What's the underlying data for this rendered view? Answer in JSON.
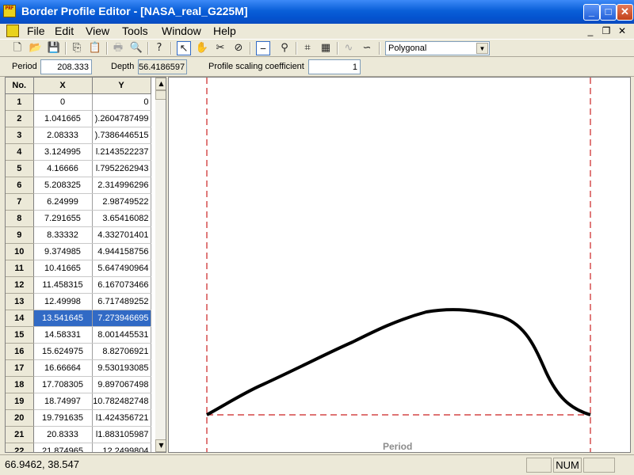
{
  "window": {
    "title": "Border Profile Editor - [NASA_real_G225M]",
    "icon_text": "PRF",
    "min": "_",
    "max": "□",
    "close": "✕"
  },
  "menu": {
    "items": [
      "File",
      "Edit",
      "View",
      "Tools",
      "Window",
      "Help"
    ],
    "mdi_minimize": "_",
    "mdi_restore": "❐",
    "mdi_close": "✕"
  },
  "toolbar": {
    "icons": [
      "new-file-icon",
      "open-folder-icon",
      "save-icon",
      "copy-icon",
      "paste-icon",
      "print-icon",
      "print-preview-icon",
      "help-icon",
      "pointer-icon",
      "hand-icon",
      "cut-icon",
      "zoom-icon",
      "line-tool-icon",
      "magnify-icon",
      "grid-icon",
      "grid-lines-icon",
      "spline-icon",
      "curve-icon"
    ],
    "mode_value": "Polygonal"
  },
  "params": {
    "period_label": "Period",
    "period_value": "208.333",
    "depth_label": "Depth",
    "depth_value": "56.4186597",
    "scaling_label": "Profile scaling coefficient",
    "scaling_value": "1"
  },
  "table": {
    "headers": [
      "No.",
      "X",
      "Y"
    ],
    "selected_row": 14,
    "rows": [
      [
        "1",
        "0",
        "0"
      ],
      [
        "2",
        "1.041665",
        ").2604787499"
      ],
      [
        "3",
        "2.08333",
        ").7386446515"
      ],
      [
        "4",
        "3.124995",
        "l.2143522237"
      ],
      [
        "5",
        "4.16666",
        "l.7952262943"
      ],
      [
        "6",
        "5.208325",
        "2.314996296"
      ],
      [
        "7",
        "6.24999",
        "2.98749522"
      ],
      [
        "8",
        "7.291655",
        "3.65416082"
      ],
      [
        "9",
        "8.33332",
        "4.332701401"
      ],
      [
        "10",
        "9.374985",
        "4.944158756"
      ],
      [
        "11",
        "10.41665",
        "5.647490964"
      ],
      [
        "12",
        "11.458315",
        "6.167073466"
      ],
      [
        "13",
        "12.49998",
        "6.717489252"
      ],
      [
        "14",
        "13.541645",
        "7.273946695"
      ],
      [
        "15",
        "14.58331",
        "8.001445531"
      ],
      [
        "16",
        "15.624975",
        "8.82706921"
      ],
      [
        "17",
        "16.66664",
        "9.530193085"
      ],
      [
        "18",
        "17.708305",
        "9.897067498"
      ],
      [
        "19",
        "18.74997",
        "10.782482748"
      ],
      [
        "20",
        "19.791635",
        "l1.424356721"
      ],
      [
        "21",
        "20.8333",
        "l1.883105987"
      ],
      [
        "22",
        "21.874965",
        "12.2499804"
      ]
    ]
  },
  "canvas": {
    "axis_label": "Period",
    "profile_color": "#000000",
    "boundary_color": "#cc2222"
  },
  "status": {
    "coords": "66.9462, 38.547",
    "num": "NUM"
  }
}
